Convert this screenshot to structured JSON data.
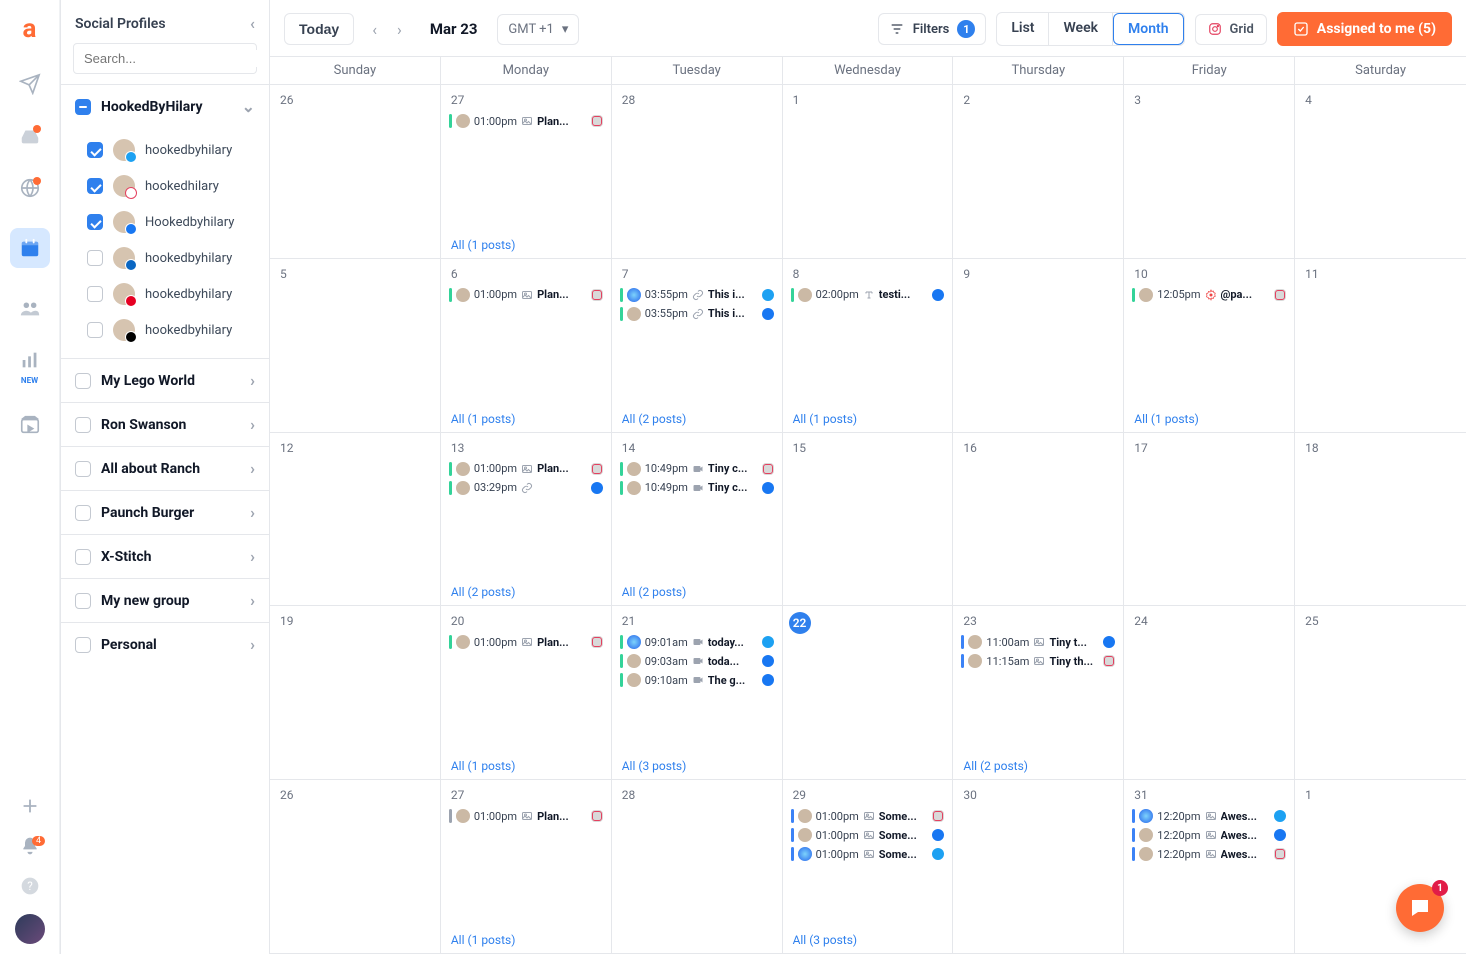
{
  "rail": {
    "new_label": "NEW",
    "notif_count": "4"
  },
  "sidebar": {
    "title": "Social Profiles",
    "search_placeholder": "Search...",
    "groups": [
      {
        "name": "HookedByHilary",
        "checked": "partial",
        "expanded": true,
        "accounts": [
          {
            "name": "hookedbyhilary",
            "net": "tw",
            "checked": true
          },
          {
            "name": "hookedhilary",
            "net": "ig",
            "checked": true
          },
          {
            "name": "Hookedbyhilary",
            "net": "fb",
            "checked": true
          },
          {
            "name": "hookedbyhilary",
            "net": "li",
            "checked": false
          },
          {
            "name": "hookedbyhilary",
            "net": "pi",
            "checked": false
          },
          {
            "name": "hookedbyhilary",
            "net": "tk",
            "checked": false
          }
        ]
      },
      {
        "name": "My Lego World"
      },
      {
        "name": "Ron Swanson"
      },
      {
        "name": "All about Ranch"
      },
      {
        "name": "Paunch Burger"
      },
      {
        "name": "X-Stitch"
      },
      {
        "name": "My new group"
      },
      {
        "name": "Personal"
      }
    ]
  },
  "toolbar": {
    "today": "Today",
    "date": "Mar 23",
    "tz": "GMT +1",
    "filters": "Filters",
    "filters_count": "1",
    "views": {
      "list": "List",
      "week": "Week",
      "month": "Month",
      "grid": "Grid"
    },
    "assigned": "Assigned to me (5)"
  },
  "days": [
    "Sunday",
    "Monday",
    "Tuesday",
    "Wednesday",
    "Thursday",
    "Friday",
    "Saturday"
  ],
  "weeks": [
    [
      {
        "n": "26"
      },
      {
        "n": "27",
        "events": [
          {
            "bar": "g",
            "t": "01:00pm",
            "ic": "img",
            "ti": "Plan...",
            "net": "ig"
          }
        ],
        "all": "All (1 posts)"
      },
      {
        "n": "28"
      },
      {
        "n": "1"
      },
      {
        "n": "2"
      },
      {
        "n": "3"
      },
      {
        "n": "4"
      }
    ],
    [
      {
        "n": "5"
      },
      {
        "n": "6",
        "events": [
          {
            "bar": "g",
            "t": "01:00pm",
            "ic": "img",
            "ti": "Plan...",
            "net": "ig"
          }
        ],
        "all": "All (1 posts)"
      },
      {
        "n": "7",
        "events": [
          {
            "bar": "g",
            "av": "globe",
            "t": "03:55pm",
            "ic": "link",
            "ti": "This i...",
            "net": "tw"
          },
          {
            "bar": "g",
            "t": "03:55pm",
            "ic": "link",
            "ti": "This i...",
            "net": "fb"
          }
        ],
        "all": "All (2 posts)"
      },
      {
        "n": "8",
        "events": [
          {
            "bar": "g",
            "t": "02:00pm",
            "ic": "txt",
            "ti": "testi...",
            "net": "fb"
          }
        ],
        "all": "All (1 posts)"
      },
      {
        "n": "9"
      },
      {
        "n": "10",
        "events": [
          {
            "bar": "g",
            "t": "12:05pm",
            "ic": "gear",
            "ti": "@pa...",
            "net": "ig"
          }
        ],
        "all": "All (1 posts)"
      },
      {
        "n": "11"
      }
    ],
    [
      {
        "n": "12"
      },
      {
        "n": "13",
        "events": [
          {
            "bar": "g",
            "t": "01:00pm",
            "ic": "img",
            "ti": "Plan...",
            "net": "ig"
          },
          {
            "bar": "g",
            "t": "03:29pm",
            "ic": "link",
            "ti": "",
            "net": "fb"
          }
        ],
        "all": "All (2 posts)"
      },
      {
        "n": "14",
        "events": [
          {
            "bar": "g",
            "t": "10:49pm",
            "ic": "vid",
            "ti": "Tiny c...",
            "net": "ig"
          },
          {
            "bar": "g",
            "t": "10:49pm",
            "ic": "vid",
            "ti": "Tiny c...",
            "net": "fb"
          }
        ],
        "all": "All (2 posts)"
      },
      {
        "n": "15"
      },
      {
        "n": "16"
      },
      {
        "n": "17"
      },
      {
        "n": "18"
      }
    ],
    [
      {
        "n": "19"
      },
      {
        "n": "20",
        "events": [
          {
            "bar": "g",
            "t": "01:00pm",
            "ic": "img",
            "ti": "Plan...",
            "net": "ig"
          }
        ],
        "all": "All (1 posts)"
      },
      {
        "n": "21",
        "events": [
          {
            "bar": "g",
            "av": "globe",
            "t": "09:01am",
            "ic": "vid",
            "ti": "today...",
            "net": "tw"
          },
          {
            "bar": "g",
            "t": "09:03am",
            "ic": "vid",
            "ti": "toda...",
            "net": "fb"
          },
          {
            "bar": "g",
            "t": "09:10am",
            "ic": "vid",
            "ti": "The g...",
            "net": "fb"
          }
        ],
        "all": "All (3 posts)"
      },
      {
        "n": "22",
        "today": true
      },
      {
        "n": "23",
        "events": [
          {
            "bar": "b",
            "t": "11:00am",
            "ic": "img",
            "ti": "Tiny t...",
            "net": "fb"
          },
          {
            "bar": "b",
            "t": "11:15am",
            "ic": "img",
            "ti": "Tiny th...",
            "net": "ig"
          }
        ],
        "all": "All (2 posts)"
      },
      {
        "n": "24"
      },
      {
        "n": "25"
      }
    ],
    [
      {
        "n": "26"
      },
      {
        "n": "27",
        "events": [
          {
            "bar": "gr",
            "t": "01:00pm",
            "ic": "img",
            "ti": "Plan...",
            "net": "ig"
          }
        ],
        "all": "All (1 posts)"
      },
      {
        "n": "28"
      },
      {
        "n": "29",
        "events": [
          {
            "bar": "b",
            "t": "01:00pm",
            "ic": "img",
            "ti": "Some...",
            "net": "ig"
          },
          {
            "bar": "b",
            "t": "01:00pm",
            "ic": "img",
            "ti": "Some...",
            "net": "fb"
          },
          {
            "bar": "b",
            "av": "globe",
            "t": "01:00pm",
            "ic": "img",
            "ti": "Some...",
            "net": "tw"
          }
        ],
        "all": "All (3 posts)"
      },
      {
        "n": "30"
      },
      {
        "n": "31",
        "events": [
          {
            "bar": "b",
            "av": "globe",
            "t": "12:20pm",
            "ic": "img",
            "ti": "Awes...",
            "net": "tw"
          },
          {
            "bar": "b",
            "t": "12:20pm",
            "ic": "img",
            "ti": "Awes...",
            "net": "fb"
          },
          {
            "bar": "b",
            "t": "12:20pm",
            "ic": "img",
            "ti": "Awes...",
            "net": "ig"
          }
        ]
      },
      {
        "n": "1"
      }
    ]
  ],
  "fab_badge": "1"
}
